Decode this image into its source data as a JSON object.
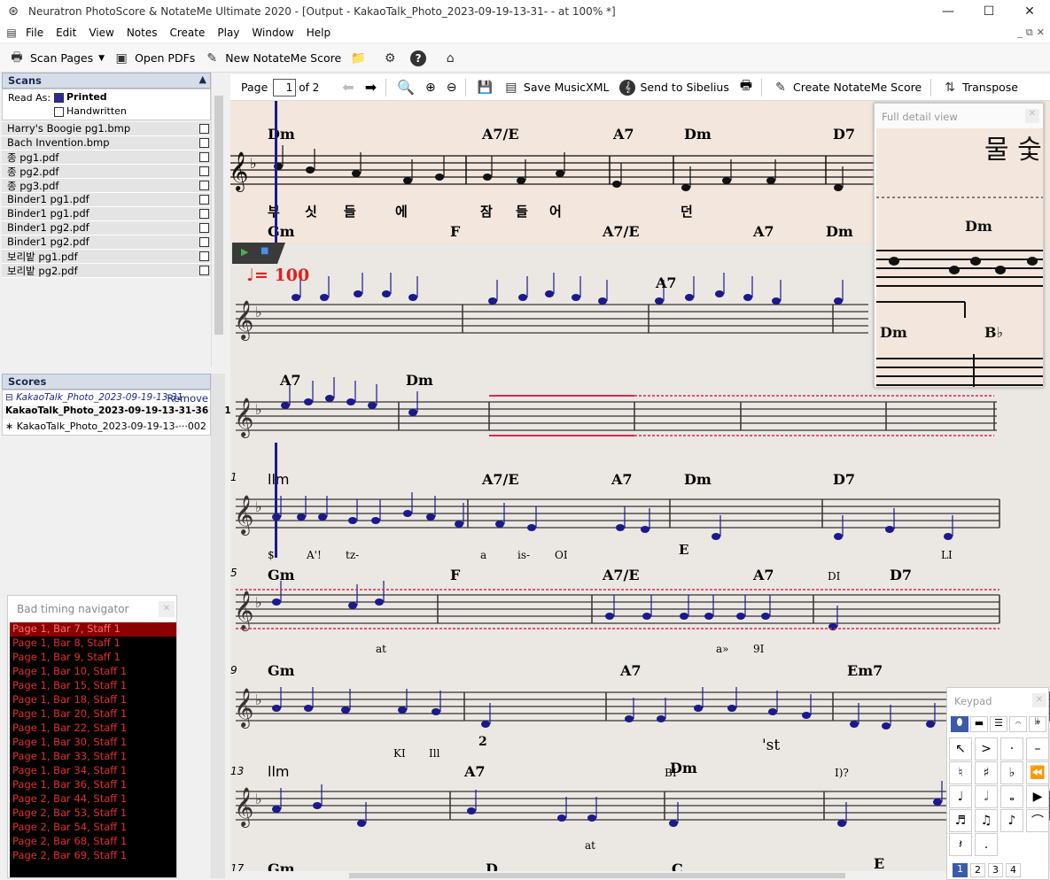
{
  "window": {
    "title": "Neuratron PhotoScore & NotateMe Ultimate 2020 - [Output - KakaoTalk_Photo_2023-09-19-13-31- - at 100% *]"
  },
  "menu": [
    "File",
    "Edit",
    "View",
    "Notes",
    "Create",
    "Play",
    "Window",
    "Help"
  ],
  "toolbar": {
    "scan_pages": "Scan Pages",
    "open_pdfs": "Open PDFs",
    "new_notateme": "New NotateMe Score"
  },
  "scans": {
    "header": "Scans",
    "read_as": "Read As:",
    "printed": "Printed",
    "handwritten": "Handwritten",
    "files": [
      "Harry's Boogie pg1.bmp",
      "Bach Invention.bmp",
      "종 pg1.pdf",
      "종 pg2.pdf",
      "종 pg3.pdf",
      "Binder1 pg1.pdf",
      "Binder1 pg1.pdf",
      "Binder1 pg2.pdf",
      "Binder1 pg2.pdf",
      "보리밭 pg1.pdf",
      "보리밭 pg2.pdf"
    ]
  },
  "scores": {
    "header": "Scores",
    "group": "KakaoTalk_Photo_2023-09-19-13-31",
    "remove": "Remove",
    "items": [
      "KakaoTalk_Photo_2023-09-19-13-31-36 001",
      "KakaoTalk_Photo_2023-09-19-13-···002"
    ]
  },
  "pagebar": {
    "page_label": "Page",
    "page_value": "1",
    "of": "of 2",
    "save_musicxml": "Save MusicXML",
    "send_sibelius": "Send to Sibelius",
    "create_notateme": "Create NotateMe Score",
    "transpose": "Transpose"
  },
  "detail_view": {
    "title": "Full detail view"
  },
  "navigator": {
    "title": "Bad timing navigator",
    "items": [
      "Page 1, Bar 7, Staff 1",
      "Page 1, Bar 8, Staff 1",
      "Page 1, Bar 9, Staff 1",
      "Page 1, Bar 10, Staff 1",
      "Page 1, Bar 15, Staff 1",
      "Page 1, Bar 18, Staff 1",
      "Page 1, Bar 20, Staff 1",
      "Page 1, Bar 22, Staff 1",
      "Page 1, Bar 30, Staff 1",
      "Page 1, Bar 33, Staff 1",
      "Page 1, Bar 34, Staff 1",
      "Page 1, Bar 36, Staff 1",
      "Page 2, Bar 44, Staff 1",
      "Page 2, Bar 53, Staff 1",
      "Page 2, Bar 54, Staff 1",
      "Page 2, Bar 68, Staff 1",
      "Page 2, Bar 69, Staff 1"
    ]
  },
  "keypad": {
    "title": "Keypad",
    "tabs": [
      "1",
      "2",
      "3",
      "4"
    ]
  },
  "score": {
    "tempo": "= 100",
    "scan_chords1": [
      "Dm",
      "A7/E",
      "A7",
      "Dm",
      "D7"
    ],
    "scan_lyrics": [
      "부",
      "싯",
      "들",
      "에",
      "잠",
      "들",
      "어",
      "던"
    ],
    "scan_chords2": [
      "Gm",
      "F",
      "A7/E",
      "A7",
      "Dm"
    ],
    "row1_chords": [
      "A7"
    ],
    "row2_chords": [
      "A7",
      "Dm"
    ],
    "sys1": {
      "bar": "1",
      "chords": [
        "llm",
        "A7/E",
        "A7",
        "Dm",
        "D7"
      ],
      "lyrics": [
        "$-",
        "A'!",
        "tz-",
        "a",
        "is-",
        "OI",
        "E",
        "LI"
      ]
    },
    "sys2": {
      "bar": "5",
      "chords": [
        "Gm",
        "F",
        "A7/E",
        "A7",
        "DI",
        "D7"
      ],
      "lyrics": [
        "at",
        "a»",
        "9I"
      ]
    },
    "sys3": {
      "bar": "9",
      "chords": [
        "Gm",
        "A7",
        "Em7"
      ],
      "lyrics": [
        "KI",
        "Ill",
        "2",
        "'st"
      ]
    },
    "sys4": {
      "bar": "13",
      "chords": [
        "llm",
        "A7",
        "Dm",
        "BI",
        "I)?"
      ],
      "lyrics": [
        "at"
      ]
    },
    "sys5": {
      "bar": "17",
      "chords": [
        "Gm",
        "D",
        "C",
        "E"
      ]
    }
  }
}
